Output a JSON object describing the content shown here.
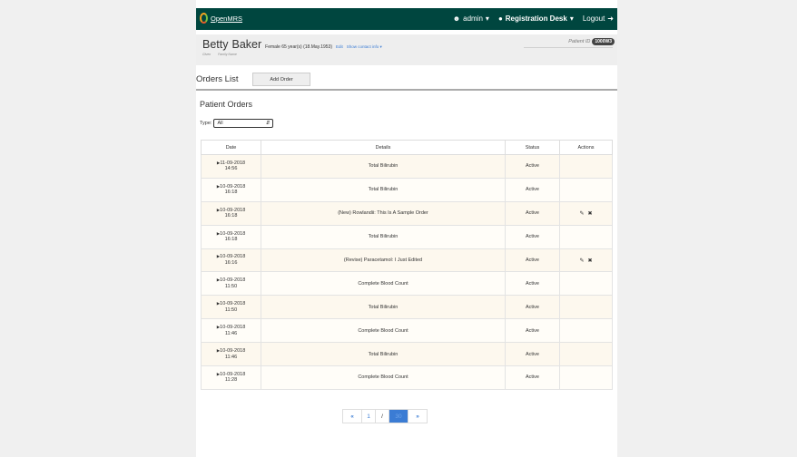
{
  "topbar": {
    "logo_text": "OpenMRS",
    "user": "admin",
    "location": "Registration Desk",
    "logout": "Logout"
  },
  "patient": {
    "given": "Betty",
    "family": "Baker",
    "info": "Female 65 year(s) (18.May.1953)",
    "edit": "Edit",
    "contact": "Show contact info",
    "given_label": "Given",
    "family_label": "Family Name",
    "id_label": "Patient ID",
    "id_value": "1000W3"
  },
  "orders_list": {
    "title": "Orders List",
    "add_button": "Add Order"
  },
  "patient_orders": {
    "title": "Patient Orders",
    "type_label": "Type:",
    "type_value": "All"
  },
  "table": {
    "headers": [
      "Date",
      "Details",
      "Status",
      "Actions"
    ],
    "rows": [
      {
        "date": "11-09-2018",
        "time": "14:56",
        "details": "Total Bilirubin",
        "status": "Active",
        "actions": false
      },
      {
        "date": "10-09-2018",
        "time": "16:18",
        "details": "Total Bilirubin",
        "status": "Active",
        "actions": false
      },
      {
        "date": "10-09-2018",
        "time": "16:18",
        "details": "(New) Rowlandii: This Is A Sample Order",
        "status": "Active",
        "actions": true
      },
      {
        "date": "10-09-2018",
        "time": "16:18",
        "details": "Total Bilirubin",
        "status": "Active",
        "actions": false
      },
      {
        "date": "10-09-2018",
        "time": "16:16",
        "details": "(Revise) Paracetamol: I Just Edited",
        "status": "Active",
        "actions": true
      },
      {
        "date": "10-09-2018",
        "time": "11:50",
        "details": "Complete Blood Count",
        "status": "Active",
        "actions": false
      },
      {
        "date": "10-09-2018",
        "time": "11:50",
        "details": "Total Bilirubin",
        "status": "Active",
        "actions": false
      },
      {
        "date": "10-09-2018",
        "time": "11:46",
        "details": "Complete Blood Count",
        "status": "Active",
        "actions": false
      },
      {
        "date": "10-09-2018",
        "time": "11:46",
        "details": "Total Bilirubin",
        "status": "Active",
        "actions": false
      },
      {
        "date": "10-09-2018",
        "time": "11:28",
        "details": "Complete Blood Count",
        "status": "Active",
        "actions": false
      }
    ]
  },
  "pagination": {
    "first": "«",
    "page": "1",
    "separator": "/",
    "current": "30",
    "last": "»"
  },
  "colors": {
    "topbar": "#00463f",
    "link": "#3b7cd4"
  }
}
